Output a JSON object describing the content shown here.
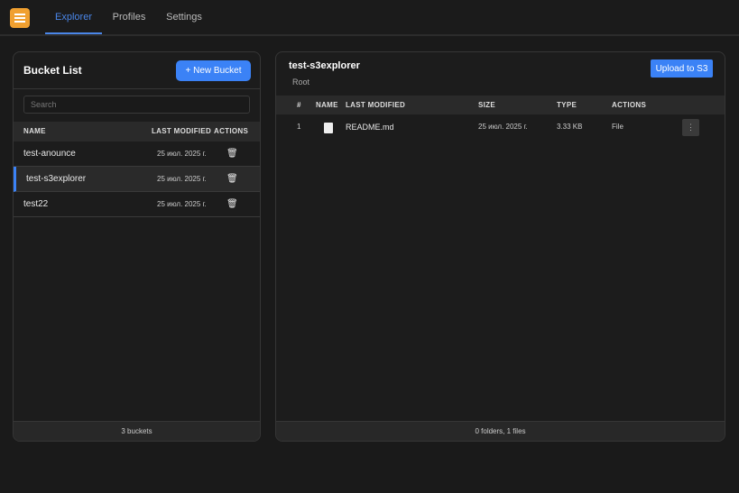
{
  "nav": {
    "tabs": [
      {
        "label": "Explorer",
        "active": true
      },
      {
        "label": "Profiles"
      },
      {
        "label": "Settings"
      }
    ]
  },
  "colors": {
    "accent": "#3b82f6",
    "logo": "#f0a030",
    "background": "#1a1a1a"
  },
  "bucket_list": {
    "title": "Bucket List",
    "new_button": "+ New Bucket",
    "search_placeholder": "Search",
    "columns": [
      "NAME",
      "LAST MODIFIED",
      "ACTIONS"
    ],
    "rows": [
      {
        "name": "test-anounce",
        "modified": "25 июл. 2025 г.",
        "action_icon": "trash-icon"
      },
      {
        "name": "test-s3explorer",
        "modified": "25 июл. 2025 г.",
        "action_icon": "trash-icon",
        "selected": true
      },
      {
        "name": "test22",
        "modified": "25 июл. 2025 г.",
        "action_icon": "trash-icon"
      }
    ],
    "footer": "3 buckets"
  },
  "explorer": {
    "title": "test-s3explorer",
    "breadcrumb": "Root",
    "upload_button": "Upload to S3",
    "columns": [
      "#",
      "NAME",
      "LAST MODIFIED",
      "SIZE",
      "TYPE",
      "ACTIONS"
    ],
    "rows": [
      {
        "index": "1",
        "icon": "file-icon",
        "name": "README.md",
        "modified": "25 июл. 2025 г.",
        "size": "3.33 KB",
        "type": "File",
        "action_icon": "more-vertical-icon"
      }
    ],
    "footer": "0 folders, 1 files"
  }
}
